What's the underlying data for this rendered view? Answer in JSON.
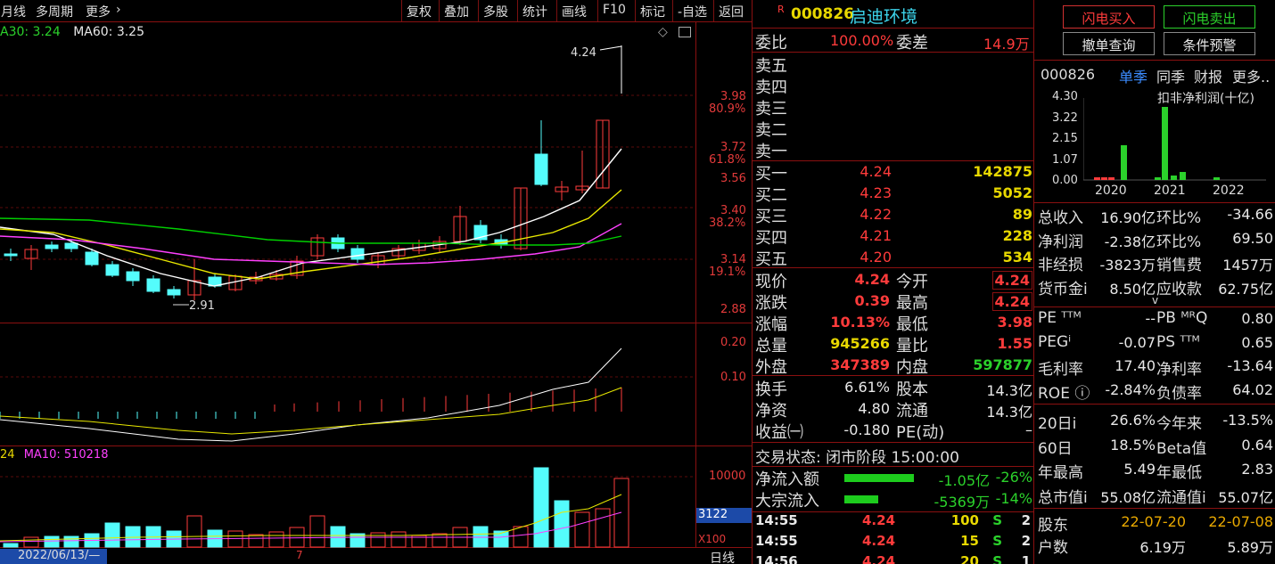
{
  "toolbar": {
    "period": "月线",
    "multi": "多周期",
    "more": "更多",
    "buttons": [
      "复权",
      "叠加",
      "多股",
      "统计",
      "画线",
      "F10",
      "标记",
      "-自选",
      "返回"
    ]
  },
  "ma_legend": {
    "ma30": "A30: 3.24",
    "ma60": "MA60: 3.25"
  },
  "price_axis": {
    "labels": [
      {
        "price": "3.98",
        "pct": "80.9%"
      },
      {
        "price": "3.72",
        "pct": "61.8%"
      },
      {
        "price": "3.56",
        "pct": ""
      },
      {
        "price": "3.40",
        "pct": "38.2%"
      },
      {
        "price": "3.14",
        "pct": "19.1%"
      },
      {
        "price": "2.88",
        "pct": ""
      }
    ],
    "high_mark": "4.24",
    "low_mark": "2.91"
  },
  "indicator_axis": [
    "0.20",
    "0.10"
  ],
  "volume": {
    "legend_a": "24",
    "legend_b": "MA10: 510218",
    "axis": "10000",
    "current": "3122",
    "multiplier": "X100"
  },
  "bottom": {
    "date": "2022/06/13/—",
    "mark": "7",
    "period": "日线"
  },
  "stock": {
    "flag": "R",
    "code": "000826",
    "name": "启迪环境"
  },
  "weibi": {
    "label": "委比",
    "value": "100.00%",
    "diff_label": "委差",
    "diff": "14.9万"
  },
  "asks": [
    "卖五",
    "卖四",
    "卖三",
    "卖二",
    "卖一"
  ],
  "bids": [
    {
      "label": "买一",
      "price": "4.24",
      "vol": "142875"
    },
    {
      "label": "买二",
      "price": "4.23",
      "vol": "5052"
    },
    {
      "label": "买三",
      "price": "4.22",
      "vol": "89"
    },
    {
      "label": "买四",
      "price": "4.21",
      "vol": "228"
    },
    {
      "label": "买五",
      "price": "4.20",
      "vol": "534"
    }
  ],
  "quote": [
    {
      "l": "现价",
      "v": "4.24",
      "l2": "今开",
      "v2": "4.24"
    },
    {
      "l": "涨跌",
      "v": "0.39",
      "l2": "最高",
      "v2": "4.24"
    },
    {
      "l": "涨幅",
      "v": "10.13%",
      "l2": "最低",
      "v2": "3.98"
    },
    {
      "l": "总量",
      "v": "945266",
      "l2": "量比",
      "v2": "1.55"
    },
    {
      "l": "外盘",
      "v": "347389",
      "l2": "内盘",
      "v2": "597877"
    }
  ],
  "fin": [
    {
      "l": "换手",
      "v": "6.61%",
      "l2": "股本",
      "v2": "14.3亿"
    },
    {
      "l": "净资",
      "v": "4.80",
      "l2": "流通",
      "v2": "14.3亿"
    },
    {
      "l": "收益㈠",
      "v": "-0.180",
      "l2": "PE(动)",
      "v2": "–"
    }
  ],
  "status": {
    "label": "交易状态:",
    "value": "闭市阶段 15:00:00"
  },
  "flow": [
    {
      "l": "净流入额",
      "v": "-1.05亿",
      "p": "-26%"
    },
    {
      "l": "大宗流入",
      "v": "-5369万",
      "p": "-14%"
    }
  ],
  "ticks": [
    {
      "t": "14:55",
      "p": "4.24",
      "v": "100",
      "s": "S",
      "n": "2"
    },
    {
      "t": "14:55",
      "p": "4.24",
      "v": "15",
      "s": "S",
      "n": "2"
    },
    {
      "t": "14:56",
      "p": "4.24",
      "v": "20",
      "s": "S",
      "n": "1"
    }
  ],
  "actions": {
    "buy": "闪电买入",
    "sell": "闪电卖出",
    "cancel": "撤单查询",
    "cond": "条件预警"
  },
  "profit": {
    "code": "000826",
    "tabs": [
      "单季",
      "同季",
      "财报",
      "更多.."
    ],
    "title": "扣非净利润(十亿)",
    "yticks": [
      "4.30",
      "3.22",
      "2.15",
      "1.07",
      "0.00"
    ],
    "years": [
      "2020",
      "2021",
      "2022"
    ]
  },
  "stats": [
    {
      "l": "总收入",
      "v": "16.90亿",
      "l2": "环比%",
      "v2": "-34.66"
    },
    {
      "l": "净利润",
      "v": "-2.38亿",
      "l2": "环比%",
      "v2": "69.50"
    },
    {
      "l": "非经损",
      "v": "-3823万",
      "l2": "销售费",
      "v2": "1457万"
    },
    {
      "l": "货币金i",
      "v": "8.50亿",
      "l2": "应收款",
      "v2": "62.75亿"
    }
  ],
  "expand": "v",
  "ratios": [
    {
      "l": "PE ᵀᵀᴹ",
      "v": "--",
      "l2": "PB ᴹᴿQ",
      "v2": "0.80"
    },
    {
      "l": "PEGⁱ",
      "v": "-0.07",
      "l2": "PS ᵀᵀᴹ",
      "v2": "0.65"
    },
    {
      "l": "毛利率",
      "v": "17.40",
      "l2": "净利率",
      "v2": "-13.64"
    },
    {
      "l": "ROE ⓘ",
      "v": "-2.84%",
      "l2": "负债率",
      "v2": "64.02"
    }
  ],
  "perf": [
    {
      "l": "20日i",
      "v": "26.6%",
      "l2": "今年来",
      "v2": "-13.5%"
    },
    {
      "l": "60日",
      "v": "18.5%",
      "l2": "Beta值",
      "v2": "0.64"
    },
    {
      "l": "年最高",
      "v": "5.49",
      "l2": "年最低",
      "v2": "2.83"
    },
    {
      "l": "总市值i",
      "v": "55.08亿",
      "l2": "流通值i",
      "v2": "55.07亿"
    }
  ],
  "holders": [
    {
      "l": "股东",
      "v": "22-07-20",
      "v2": "22-07-08"
    },
    {
      "l": "户数",
      "v": "6.19万",
      "v2": "5.89万"
    }
  ],
  "colors": {
    "up": "#ff3b3b",
    "down": "#54fcfc",
    "ma_white": "#ffffff",
    "ma_yellow": "#e8e800",
    "ma_magenta": "#ff40ff",
    "ma_green": "#00d000"
  }
}
